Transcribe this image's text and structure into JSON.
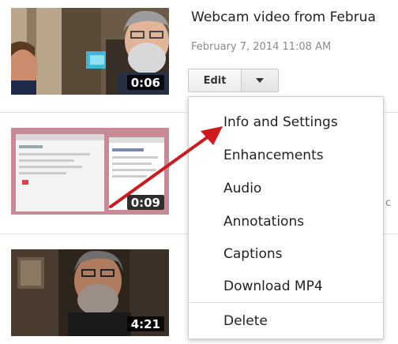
{
  "videos": [
    {
      "title": "Webcam video from Februa",
      "date": "February 7, 2014 11:08 AM",
      "duration": "0:06"
    },
    {
      "duration": "0:09"
    },
    {
      "duration": "4:21"
    }
  ],
  "edit": {
    "label": "Edit",
    "dropdown_icon": "caret-down-icon"
  },
  "menu": {
    "items": [
      "Info and Settings",
      "Enhancements",
      "Audio",
      "Annotations",
      "Captions",
      "Download MP4",
      "Delete"
    ]
  },
  "annotation": {
    "arrow_color": "#d0191c",
    "icon": "red-arrow-icon"
  },
  "stray_text": "c"
}
